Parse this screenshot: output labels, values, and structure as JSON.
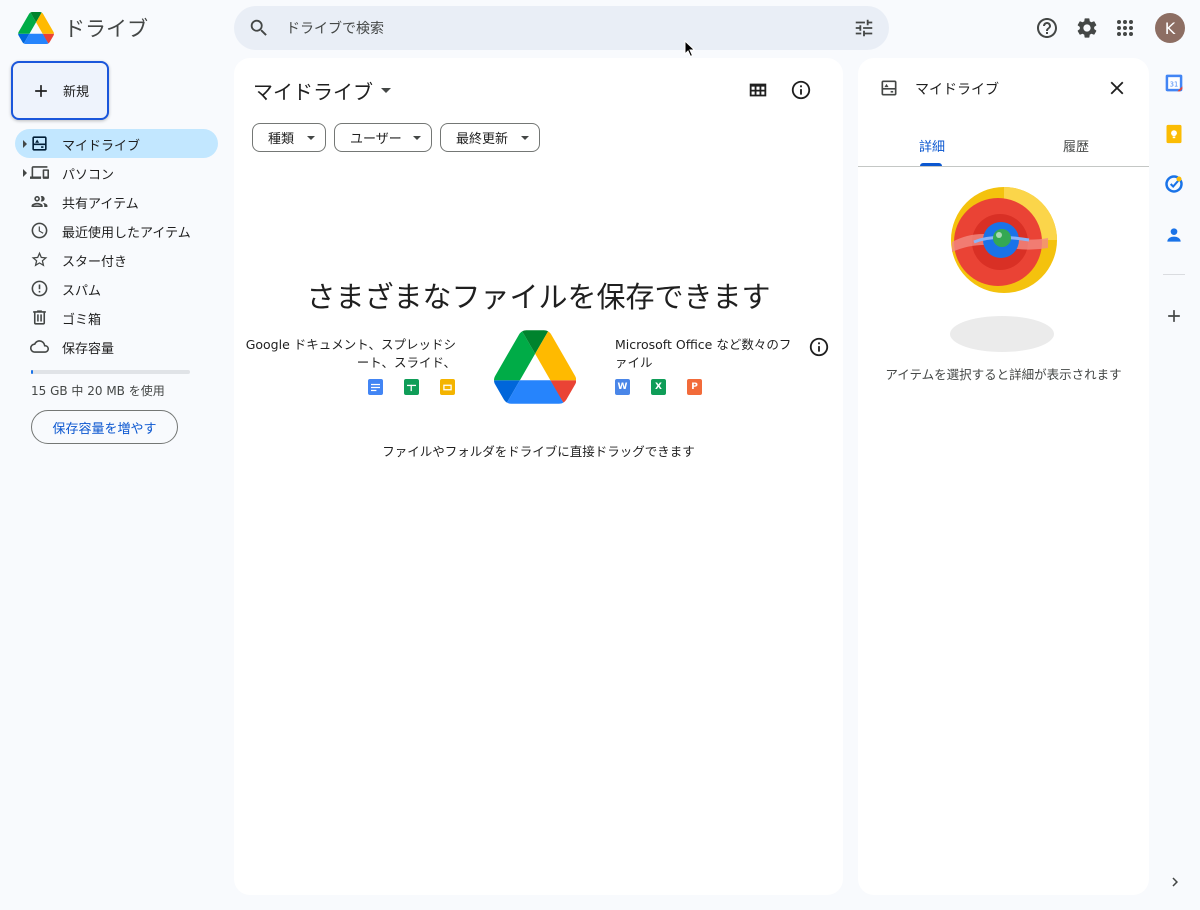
{
  "app": {
    "title": "ドライブ"
  },
  "search": {
    "placeholder": "ドライブで検索"
  },
  "user": {
    "avatar_initial": "K"
  },
  "sidebar": {
    "new_label": "新規",
    "items": [
      {
        "label": "マイドライブ"
      },
      {
        "label": "パソコン"
      },
      {
        "label": "共有アイテム"
      },
      {
        "label": "最近使用したアイテム"
      },
      {
        "label": "スター付き"
      },
      {
        "label": "スパム"
      },
      {
        "label": "ゴミ箱"
      },
      {
        "label": "保存容量"
      }
    ],
    "storage_text": "15 GB 中 20 MB を使用",
    "storage_button": "保存容量を増やす"
  },
  "main": {
    "title": "マイドライブ",
    "filters": [
      {
        "label": "種類"
      },
      {
        "label": "ユーザー"
      },
      {
        "label": "最終更新"
      }
    ],
    "empty_title": "さまざまなファイルを保存できます",
    "promo_left_line1": "Google ドキュメント、スプレッドシ",
    "promo_left_line2": "ート、スライド、",
    "promo_right_line1": "Microsoft Office など数々のフ",
    "promo_right_line2": "ァイル",
    "office_icons": {
      "word": "W",
      "excel": "X",
      "powerpoint": "P"
    },
    "drag_hint": "ファイルやフォルダをドライブに直接ドラッグできます"
  },
  "details": {
    "title": "マイドライブ",
    "tabs": [
      {
        "label": "詳細"
      },
      {
        "label": "履歴"
      }
    ],
    "hint": "アイテムを選択すると詳細が表示されます"
  },
  "rail": {
    "calendar_day": "31"
  },
  "colors": {
    "accent": "#0b57d0",
    "active_nav": "#c2e7ff",
    "search_bg": "#e9eef6",
    "page_bg": "#f8fafd"
  },
  "icons": [
    "search-icon",
    "tune-icon",
    "help-icon",
    "gear-icon",
    "apps-icon",
    "plus-icon",
    "drive-icon",
    "computer-icon",
    "people-icon",
    "clock-icon",
    "star-icon",
    "spam-icon",
    "trash-icon",
    "cloud-icon",
    "grid-view-icon",
    "info-icon",
    "close-icon"
  ]
}
